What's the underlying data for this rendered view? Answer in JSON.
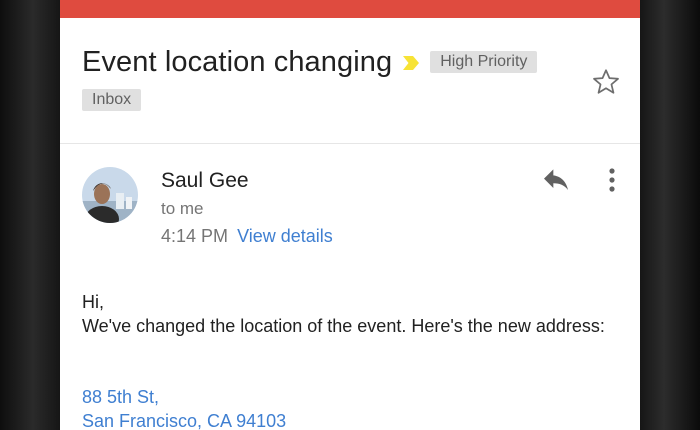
{
  "email": {
    "subject": "Event location changing",
    "labels": {
      "priority": "High Priority",
      "folder": "Inbox"
    },
    "sender": {
      "name": "Saul Gee",
      "recipient": "to me"
    },
    "time": "4:14 PM",
    "view_details": "View details",
    "body": {
      "greeting": "Hi,",
      "message": "We've changed the location of the event. Here's the new address:",
      "address_line1": "88 5th St,",
      "address_line2": "San Francisco, CA 94103"
    }
  },
  "icons": {
    "star": "star-outline-icon",
    "reply": "reply-icon",
    "more": "more-vert-icon",
    "importance": "importance-marker-icon"
  },
  "colors": {
    "app_bar": "#df4b3f",
    "importance": "#f7e336",
    "link": "#3f7fd1",
    "chip_bg": "#e0e0e0"
  }
}
